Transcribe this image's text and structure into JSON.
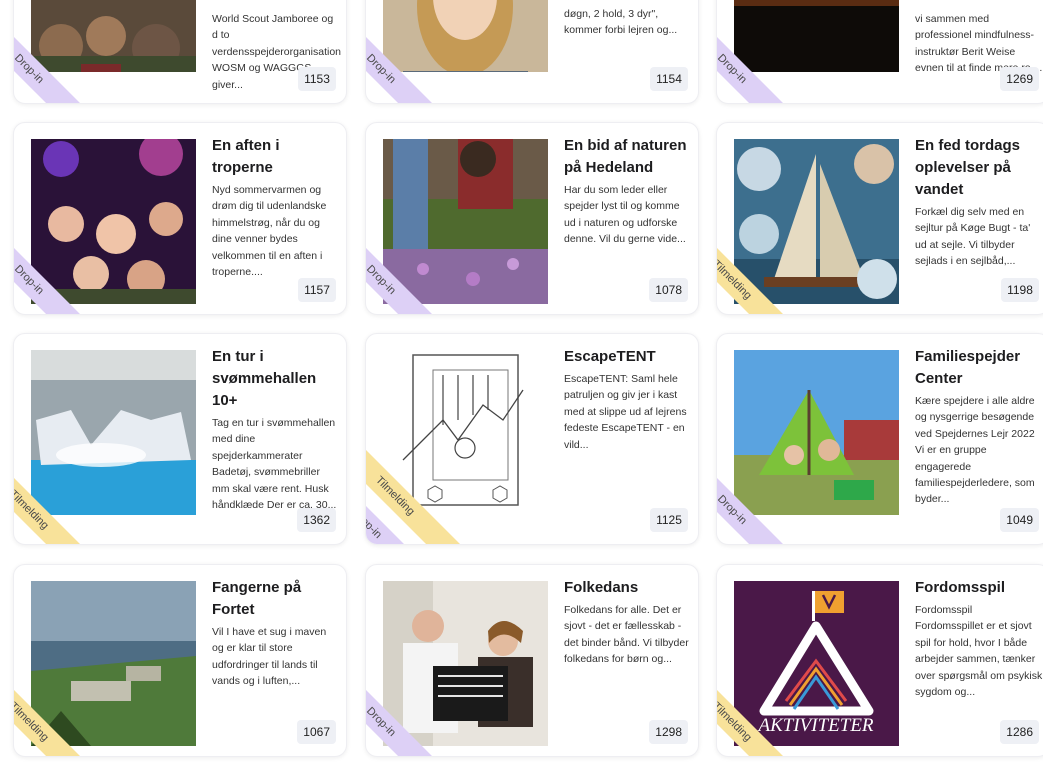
{
  "cards": [
    {
      "title": "",
      "desc": "World Scout Jamboree og d to verdensspejderorganisation WOSM og WAGGGS giver...",
      "count": "1153",
      "ribbons": [
        "Drop-in"
      ]
    },
    {
      "title": "",
      "desc": "døgn, 2 hold, 3 dyr\", kommer forbi lejren og...",
      "count": "1154",
      "ribbons": [
        "Drop-in"
      ]
    },
    {
      "title": "",
      "desc": "vi sammen med professionel mindfulness-instruktør Berit Weise evnen til at finde mere ro,...",
      "count": "1269",
      "ribbons": [
        "Drop-in"
      ]
    },
    {
      "title": "En aften i troperne",
      "desc": "Nyd sommervarmen og drøm dig til udenlandske himmelstrøg, når du og dine venner bydes velkommen til en aften i troperne....",
      "count": "1157",
      "ribbons": [
        "Drop-in"
      ]
    },
    {
      "title": "En bid af naturen på Hedeland",
      "desc": "Har du som leder eller spejder lyst til og komme ud i naturen og udforske denne. Vil du gerne vide...",
      "count": "1078",
      "ribbons": [
        "Drop-in"
      ]
    },
    {
      "title": "En fed tordags oplevelser på vandet",
      "desc": "Forkæl dig selv med en sejltur på Køge Bugt - ta' ud at sejle. Vi tilbyder sejlads i en sejlbåd,...",
      "count": "1198",
      "ribbons": [
        "Tilmelding"
      ]
    },
    {
      "title": "En tur i svømmehallen 10+",
      "desc": "Tag en tur i svømmehallen med dine spejderkammerater Badetøj, svømmebriller mm skal være rent. Husk håndklæde Der er ca. 30...",
      "count": "1362",
      "ribbons": [
        "Tilmelding"
      ]
    },
    {
      "title": "EscapeTENT",
      "desc": "EscapeTENT: Saml hele patruljen og giv jer i kast med at slippe ud af lejrens fedeste EscapeTENT - en vild...",
      "count": "1125",
      "ribbons": [
        "Tilmelding",
        "Drop-in"
      ]
    },
    {
      "title": "Familiespejder Center",
      "desc": "Kære spejdere i alle aldre og nysgerrige besøgende ved Spejdernes Lejr 2022 Vi er en gruppe engagerede familiespejderledere, som byder...",
      "count": "1049",
      "ribbons": [
        "Drop-in"
      ]
    },
    {
      "title": "Fangerne på Fortet",
      "desc": "Vil I have et sug i maven og er klar til store udfordringer til lands til vands og i luften,...",
      "count": "1067",
      "ribbons": [
        "Tilmelding"
      ]
    },
    {
      "title": "Folkedans",
      "desc": "Folkedans for alle. Det er sjovt - det er fællesskab - det binder bånd. Vi tilbyder folkedans for børn og...",
      "count": "1298",
      "ribbons": [
        "Drop-in"
      ]
    },
    {
      "title": "Fordomsspil",
      "desc": "Fordomsspil Fordomsspillet er et sjovt spil for hold, hvor I både arbejder sammen, tænker over spørgsmål om psykisk sygdom og...",
      "count": "1286",
      "ribbons": [
        "Tilmelding"
      ]
    }
  ],
  "logo_text": "AKTIVITETER",
  "colors": {
    "drop_in": "#ddd0f6",
    "tilmelding": "#f8e29a",
    "count_bg": "#eef0f5"
  }
}
